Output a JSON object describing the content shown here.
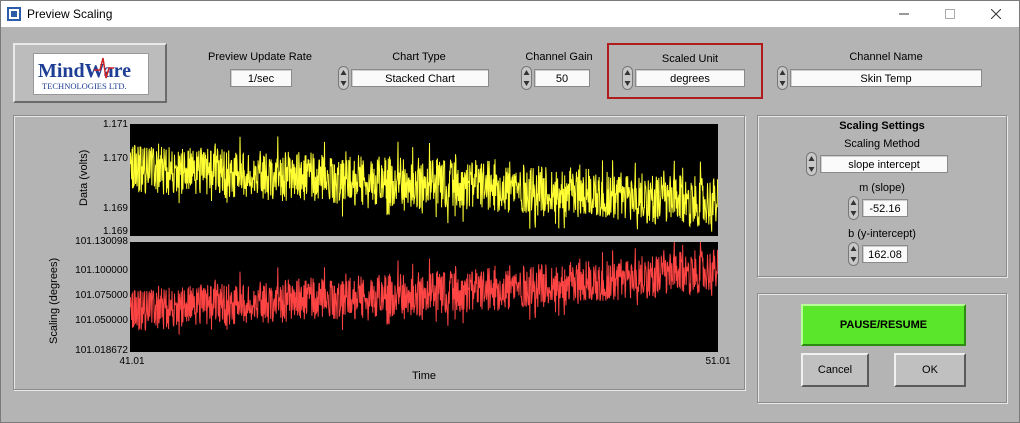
{
  "window": {
    "title": "Preview Scaling",
    "controls": [
      "minimize",
      "maximize",
      "close"
    ]
  },
  "logo": {
    "line1": "MindWare",
    "line2": "TECHNOLOGIES LTD."
  },
  "toolbar": {
    "preview_update_rate": {
      "label": "Preview Update Rate",
      "value": "1/sec"
    },
    "chart_type": {
      "label": "Chart Type",
      "value": "Stacked Chart"
    },
    "channel_gain": {
      "label": "Channel Gain",
      "value": "50"
    },
    "scaled_unit": {
      "label": "Scaled Unit",
      "value": "degrees"
    },
    "channel_name": {
      "label": "Channel Name",
      "value": "Skin Temp"
    }
  },
  "chart": {
    "x_label": "Time",
    "x_min": "41.01",
    "x_max": "51.01",
    "top": {
      "ylabel": "Data (volts)",
      "ticks": [
        "1.171",
        "1.170",
        "1.169",
        "1.169"
      ],
      "color": "#ffff33"
    },
    "bottom": {
      "ylabel": "Scaling (degrees)",
      "ticks": [
        "101.130098",
        "101.100000",
        "101.075000",
        "101.050000",
        "101.018672"
      ],
      "color": "#ff4444"
    }
  },
  "chart_data": [
    {
      "type": "line",
      "title": "",
      "xlabel": "Time",
      "ylabel": "Data (volts)",
      "xlim": [
        41.01,
        51.01
      ],
      "ylim": [
        1.169,
        1.171
      ],
      "series": [
        {
          "color": "#ffff33",
          "x": [
            41.01,
            42.01,
            43.01,
            44.01,
            45.01,
            46.01,
            47.01,
            48.01,
            49.01,
            50.01,
            51.01
          ],
          "values": [
            1.1702,
            1.17015,
            1.1701,
            1.17005,
            1.17,
            1.16995,
            1.1699,
            1.1698,
            1.16975,
            1.16965,
            1.1696
          ]
        }
      ]
    },
    {
      "type": "line",
      "title": "",
      "xlabel": "Time",
      "ylabel": "Scaling (degrees)",
      "xlim": [
        41.01,
        51.01
      ],
      "ylim": [
        101.018672,
        101.130098
      ],
      "series": [
        {
          "color": "#ff4444",
          "x": [
            41.01,
            42.01,
            43.01,
            44.01,
            45.01,
            46.01,
            47.01,
            48.01,
            49.01,
            50.01,
            51.01
          ],
          "values": [
            101.06,
            101.065,
            101.068,
            101.072,
            101.075,
            101.078,
            101.081,
            101.086,
            101.09,
            101.096,
            101.102
          ]
        }
      ]
    }
  ],
  "settings": {
    "title": "Scaling Settings",
    "method_label": "Scaling Method",
    "method_value": "slope intercept",
    "slope_label": "m (slope)",
    "slope_value": "-52.16",
    "intercept_label": "b (y-intercept)",
    "intercept_value": "162.08"
  },
  "actions": {
    "pause_resume": "PAUSE/RESUME",
    "cancel": "Cancel",
    "ok": "OK"
  },
  "colors": {
    "highlight": "#b01c1c",
    "pause_button": "#5ae62a"
  }
}
